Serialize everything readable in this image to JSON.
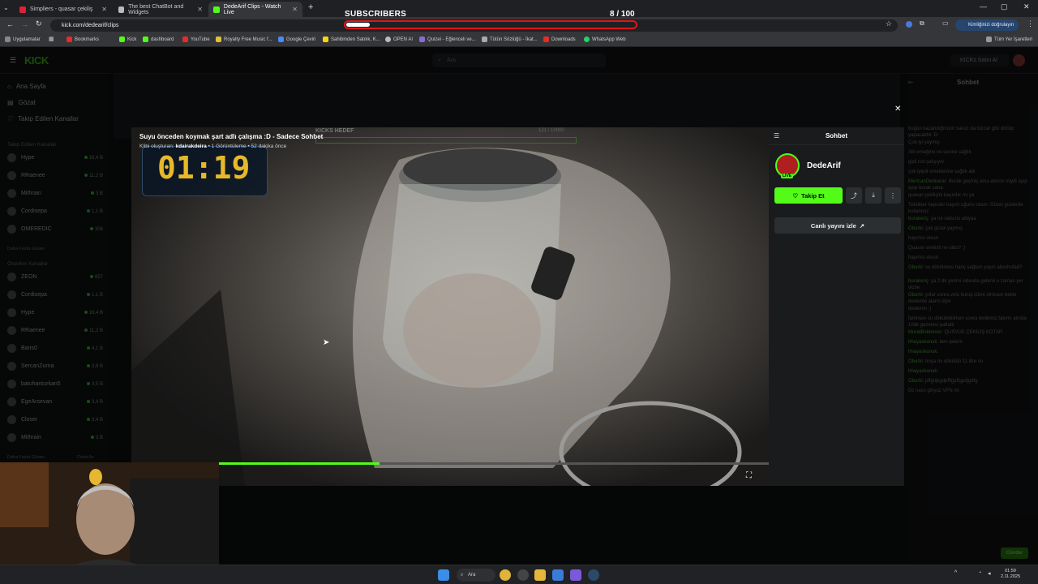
{
  "browser": {
    "tabs": [
      {
        "label": "Simpliers - quasar çekiliş",
        "color": "#e0203a"
      },
      {
        "label": "The best ChatBot and Widgets",
        "color": "#bbbbbb"
      },
      {
        "label": "DedeArif Clips - Watch Live",
        "color": "#53fc18"
      }
    ],
    "url": "kick.com/dedearif/clips",
    "profile_button": "Kimliğinizi doğrulayın",
    "bookmarks": [
      {
        "label": "Uygulamalar"
      },
      {
        "label": "Bookmarks"
      },
      {
        "label": "Kick"
      },
      {
        "label": "dashboard"
      },
      {
        "label": "YouTube"
      },
      {
        "label": "Royalty Free Music f..."
      },
      {
        "label": "Google Çeviri"
      },
      {
        "label": "Sahibinden Satılık, K..."
      },
      {
        "label": "OPEN AI"
      },
      {
        "label": "Quizei - Eğlenceli ve..."
      },
      {
        "label": "Tütün Sözlüğü - İkat..."
      },
      {
        "label": "Downloads"
      },
      {
        "label": "WhatsApp Web"
      }
    ],
    "all_bookmarks": "Tüm Yer İşaretleri"
  },
  "subscribers": {
    "label": "SUBSCRIBERS",
    "count_text": "8  / 100",
    "progress": 0.08
  },
  "kick": {
    "logo": "KICK",
    "search_placeholder": "Ara",
    "buy_kicks": "KICKs Satın Al",
    "nav": {
      "home": "Ana Sayfa",
      "browse": "Gözat",
      "following": "Takip Edilen Kanallar"
    },
    "followed_header": "Takip Edilen Kanallar",
    "followed": [
      {
        "name": "Hype",
        "count": "16,4 B"
      },
      {
        "name": "RRaenee",
        "count": "11,2 B"
      },
      {
        "name": "Mithrain",
        "count": "3 B"
      },
      {
        "name": "Cordisepa",
        "count": "1,1 B"
      },
      {
        "name": "OMEREDIC",
        "count": "306"
      }
    ],
    "show_more": "Daha Fazla Göster",
    "recommended_header": "Önerilen Kanallar",
    "recommended": [
      {
        "name": "ZEON",
        "count": "857"
      },
      {
        "name": "Cordisepa",
        "count": "1,1 B"
      },
      {
        "name": "Hype",
        "count": "16,4 B"
      },
      {
        "name": "RRaenee",
        "count": "11,2 B"
      },
      {
        "name": "Baris0",
        "count": "4,1 B"
      },
      {
        "name": "SercanZurna",
        "count": "3,9 B"
      },
      {
        "name": "batuhanturkan5",
        "count": "3,5 B"
      },
      {
        "name": "EgeArsevan",
        "count": "3,4 B"
      },
      {
        "name": "Closer",
        "count": "3,4 B"
      },
      {
        "name": "Mithrain",
        "count": "3 B"
      }
    ],
    "show_more_bottom": "Daha Fazla Göster",
    "show_less": "Daha Az",
    "bg_chat_title": "Sohbet",
    "bg_chat_send": "Gönder"
  },
  "modal": {
    "clip_title": "Suyu önceden koymak şart adlı çalışma :D - Sadece Sohbet",
    "meta_prefix": "Klibi oluşturan: ",
    "creator": "kdairakdeira",
    "meta_suffix": " • 1 Görüntüleme • 52 dakika önce",
    "timer": "01:19",
    "kicks_goal": "KICKS HEDEF",
    "kicks_goal_value": "121 / 10000",
    "video_progress": 0.3,
    "chat_title": "Sohbet",
    "channel": "DedeArif",
    "live_badge": "LIVE",
    "follow_label": "Takip Et",
    "watch_live_label": "Canlı yayını izle"
  },
  "background_chat": [
    {
      "user": "",
      "text": "bugün kazandığınızın sakızı da tüccar gibi dönüp yapacaktık :D"
    },
    {
      "user": "",
      "text": "Çok iyi yaymış"
    },
    {
      "user": "",
      "text": "Abi emeğine ve sesine sağlık"
    },
    {
      "user": "",
      "text": "gizli not çalışıyor"
    },
    {
      "user": "",
      "text": "çok iyiydi emeklerine sağlık abi"
    },
    {
      "user": "MertcanDedearar",
      "text": "Burak geçmiş ama abone miydi ayıp ayıp burak sana"
    },
    {
      "user": "",
      "text": "quasar çekilişini kaçırdık mı ya"
    },
    {
      "user": "",
      "text": "Tebrikler hepsiler hayırlı uğurlu olsun. Güzel günlerde kullanınız"
    },
    {
      "user": "burakeriç",
      "text": "ya ne valsızsı abiyaa"
    },
    {
      "user": "Oburki",
      "text": "çok güzel yaymış"
    },
    {
      "user": "",
      "text": "hayırlısı olsun"
    },
    {
      "user": "",
      "text": "Quasar sereisti ne oldu? :)"
    },
    {
      "user": "",
      "text": "hayırlısı olsun"
    },
    {
      "user": "Oburki",
      "text": "su dökülmesi hariç sağlam yayın abschufad?"
    },
    {
      "user": "burakeriç",
      "text": "ya 2 dk yerimi videoda gelemi o zaman yer vicrie"
    },
    {
      "user": "Oburki",
      "text": "yıllar sonra volo kurup izlimi olmcam bekle dedemle alarm diye"
    },
    {
      "user": "",
      "text": "dedemin ;)"
    },
    {
      "user": "",
      "text": "farklısev su dökülebilirken sonra dedemiz takımı alında 10dk gezmesi patlattı"
    },
    {
      "user": "MuratBoldemer",
      "text": "QUSVUE ÇEKİLİŞ KOTAR"
    },
    {
      "user": "hhayaskonuk",
      "text": "ben jedem"
    },
    {
      "user": "hhayaskonuk",
      "text": ""
    },
    {
      "user": "Oburki",
      "text": "boşa mı döküldü 11 litre su"
    },
    {
      "user": "hhayaskonuk",
      "text": ""
    },
    {
      "user": "Oburki",
      "text": "jdfghjkgdpfflgjdfgpdjgdfg"
    },
    {
      "user": "",
      "text": "Dc nasıl giriyoz VPN mi"
    }
  ],
  "taskbar": {
    "search": "Ara",
    "time": "01:59",
    "date": "2.11.2025"
  }
}
